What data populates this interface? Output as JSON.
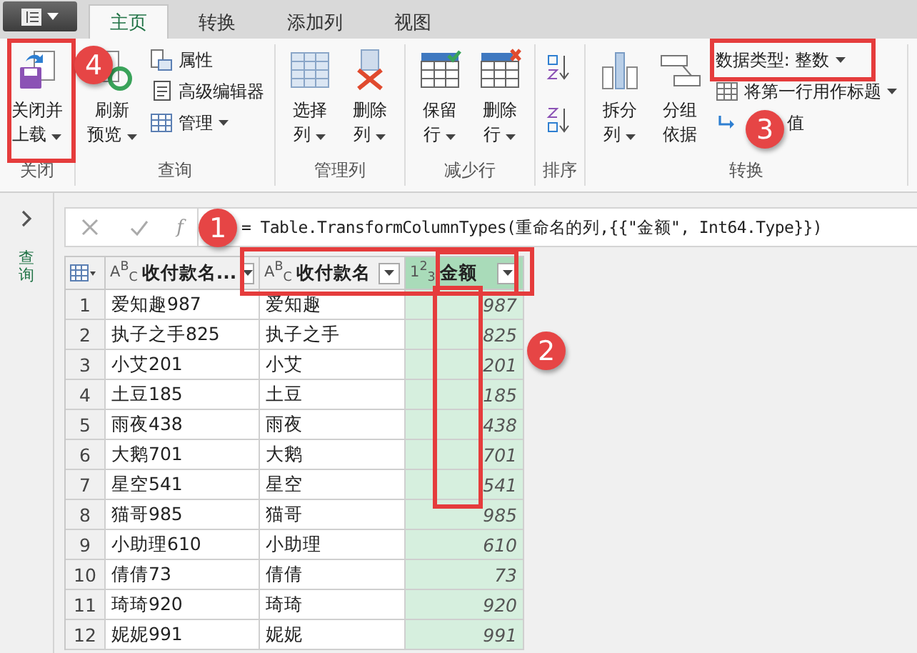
{
  "tabs": [
    {
      "label": "主页",
      "selected": true
    },
    {
      "label": "转换",
      "selected": false
    },
    {
      "label": "添加列",
      "selected": false
    },
    {
      "label": "视图",
      "selected": false
    }
  ],
  "ribbon_groups": [
    {
      "label": "关闭",
      "items": [
        {
          "kind": "large",
          "lines": [
            "关闭并",
            "上载"
          ],
          "dropdown": true
        }
      ]
    },
    {
      "label": "查询",
      "items": [
        {
          "kind": "large",
          "lines": [
            "刷新",
            "预览"
          ],
          "dropdown": true
        },
        {
          "kind": "stack",
          "rows": [
            {
              "label": "属性",
              "dropdown": false
            },
            {
              "label": "高级编辑器",
              "dropdown": false
            },
            {
              "label": "管理",
              "dropdown": true
            }
          ]
        }
      ]
    },
    {
      "label": "管理列",
      "items": [
        {
          "kind": "large",
          "lines": [
            "选择",
            "列"
          ],
          "dropdown": true
        },
        {
          "kind": "large",
          "lines": [
            "删除",
            "列"
          ],
          "dropdown": true
        }
      ]
    },
    {
      "label": "减少行",
      "items": [
        {
          "kind": "large",
          "lines": [
            "保留",
            "行"
          ],
          "dropdown": true
        },
        {
          "kind": "large",
          "lines": [
            "删除",
            "行"
          ],
          "dropdown": true
        }
      ]
    },
    {
      "label": "排序",
      "items": [
        {
          "kind": "sort"
        }
      ]
    },
    {
      "label": "转换",
      "items": [
        {
          "kind": "large",
          "lines": [
            "拆分",
            "列"
          ],
          "dropdown": true
        },
        {
          "kind": "large",
          "lines": [
            "分组",
            "依据"
          ],
          "dropdown": false
        },
        {
          "kind": "stack",
          "rows": [
            {
              "label": "数据类型: 整数",
              "dropdown": true
            },
            {
              "label": "将第一行用作标题",
              "dropdown": true
            },
            {
              "label": "值",
              "dropdown": false
            }
          ]
        }
      ]
    }
  ],
  "sidebar": {
    "title": "查询"
  },
  "formula_bar": {
    "function_button": "f",
    "formula": "= Table.TransformColumnTypes(重命名的列,{{\"金额\", Int64.Type}})"
  },
  "table": {
    "columns": [
      {
        "type": "A$^{B}$$_{C}$",
        "name": "收付款名...",
        "selected": false,
        "numeric": false
      },
      {
        "type": "A$^{B}$$_{C}$",
        "name": "收付款名",
        "selected": false,
        "numeric": false
      },
      {
        "type": "1$^{2}$$_{3}$",
        "name": "金额",
        "selected": true,
        "numeric": true
      }
    ],
    "rows": [
      {
        "index": "1",
        "cells": [
          "爱知趣987",
          "爱知趣",
          "987"
        ]
      },
      {
        "index": "2",
        "cells": [
          "执子之手825",
          "执子之手",
          "825"
        ]
      },
      {
        "index": "3",
        "cells": [
          "小艾201",
          "小艾",
          "201"
        ]
      },
      {
        "index": "4",
        "cells": [
          "土豆185",
          "土豆",
          "185"
        ]
      },
      {
        "index": "5",
        "cells": [
          "雨夜438",
          "雨夜",
          "438"
        ]
      },
      {
        "index": "6",
        "cells": [
          "大鹅701",
          "大鹅",
          "701"
        ]
      },
      {
        "index": "7",
        "cells": [
          "星空541",
          "星空",
          "541"
        ]
      },
      {
        "index": "8",
        "cells": [
          "猫哥985",
          "猫哥",
          "985"
        ]
      },
      {
        "index": "9",
        "cells": [
          "小助理610",
          "小助理",
          "610"
        ]
      },
      {
        "index": "10",
        "cells": [
          "倩倩73",
          "倩倩",
          "73"
        ]
      },
      {
        "index": "11",
        "cells": [
          "琦琦920",
          "琦琦",
          "920"
        ]
      },
      {
        "index": "12",
        "cells": [
          "妮妮991",
          "妮妮",
          "991"
        ]
      }
    ]
  },
  "annotations": [
    {
      "kind": "frame"
    },
    {
      "kind": "frame"
    },
    {
      "kind": "frame"
    },
    {
      "kind": "frame"
    },
    {
      "kind": "frame"
    },
    {
      "kind": "badge",
      "label": "4"
    },
    {
      "kind": "badge",
      "label": "3"
    },
    {
      "kind": "badge",
      "label": "1"
    },
    {
      "kind": "badge",
      "label": "2"
    }
  ]
}
